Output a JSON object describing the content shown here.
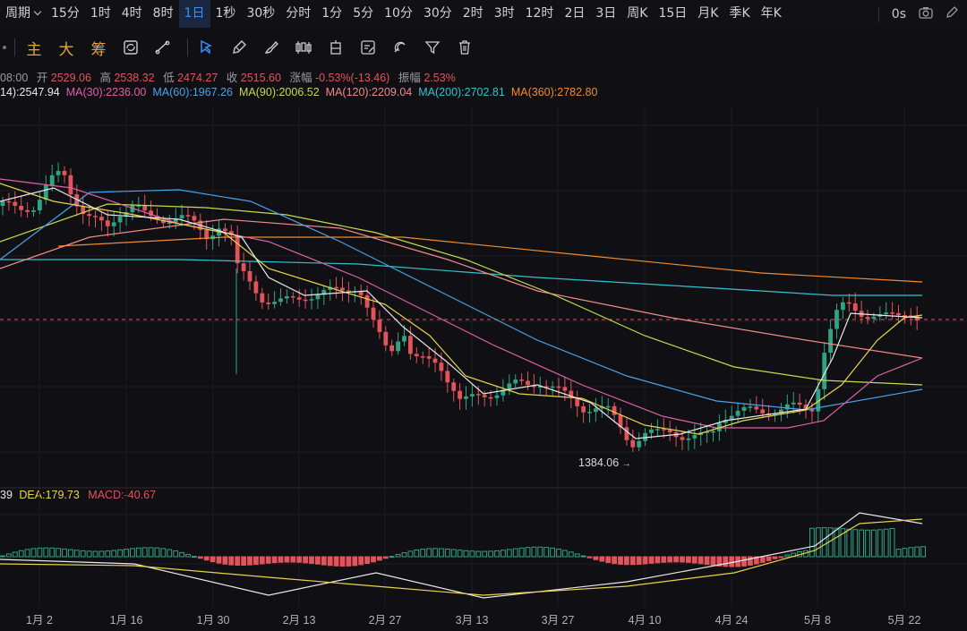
{
  "periods": [
    {
      "label": "周期"
    },
    {
      "label": "15分"
    },
    {
      "label": "1时"
    },
    {
      "label": "4时"
    },
    {
      "label": "8时"
    },
    {
      "label": "1日",
      "active": true
    },
    {
      "label": "1秒"
    },
    {
      "label": "30秒"
    },
    {
      "label": "分时"
    },
    {
      "label": "1分"
    },
    {
      "label": "5分"
    },
    {
      "label": "10分"
    },
    {
      "label": "30分"
    },
    {
      "label": "2时"
    },
    {
      "label": "3时"
    },
    {
      "label": "12时"
    },
    {
      "label": "2日"
    },
    {
      "label": "3日"
    },
    {
      "label": "周K"
    },
    {
      "label": "15日"
    },
    {
      "label": "月K"
    },
    {
      "label": "季K"
    },
    {
      "label": "年K"
    }
  ],
  "speed_label": "0s",
  "drawbar": {
    "main_label": "主",
    "big_label": "大",
    "chip_label": "筹",
    "icons": [
      "sync-icon",
      "ruler-icon",
      "select-icon",
      "pen-icon",
      "brush-icon",
      "candles-icon",
      "position-icon",
      "note-icon",
      "magnet-icon",
      "filter-icon",
      "trash-icon"
    ]
  },
  "info": {
    "time": "08:00",
    "open_label": "开",
    "open": "2529.06",
    "high_label": "高",
    "high": "2538.32",
    "low_label": "低",
    "low": "2474.27",
    "close_label": "收",
    "close": "2515.60",
    "change_label": "涨幅",
    "change": "-0.53%(-13.46)",
    "amp_label": "振幅",
    "amp": "2.53%"
  },
  "ma_items": [
    {
      "text": "14):2547.94",
      "color": "#e8e8ec"
    },
    {
      "text": "MA(30):2236.00",
      "color": "#e15fa6"
    },
    {
      "text": "MA(60):1967.26",
      "color": "#4aa3e8"
    },
    {
      "text": "MA(90):2006.52",
      "color": "#c7d94e"
    },
    {
      "text": "MA(120):2209.04",
      "color": "#f08a8a"
    },
    {
      "text": "MA(200):2702.81",
      "color": "#33c1d1"
    },
    {
      "text": "MA(360):2782.80",
      "color": "#f08a2e"
    }
  ],
  "macd": {
    "dif_partial": "39",
    "dea": "DEA:179.73",
    "macd": "MACD:-40.67"
  },
  "low_marker": "1384.06",
  "x_labels": [
    "1月 2",
    "1月 16",
    "1月 30",
    "2月 13",
    "2月 27",
    "3月 13",
    "3月 27",
    "4月 10",
    "4月 24",
    "5月 8",
    "5月 22"
  ],
  "colors": {
    "up": "#2ea483",
    "down": "#e0545a",
    "accent": "#3d8bff"
  }
}
